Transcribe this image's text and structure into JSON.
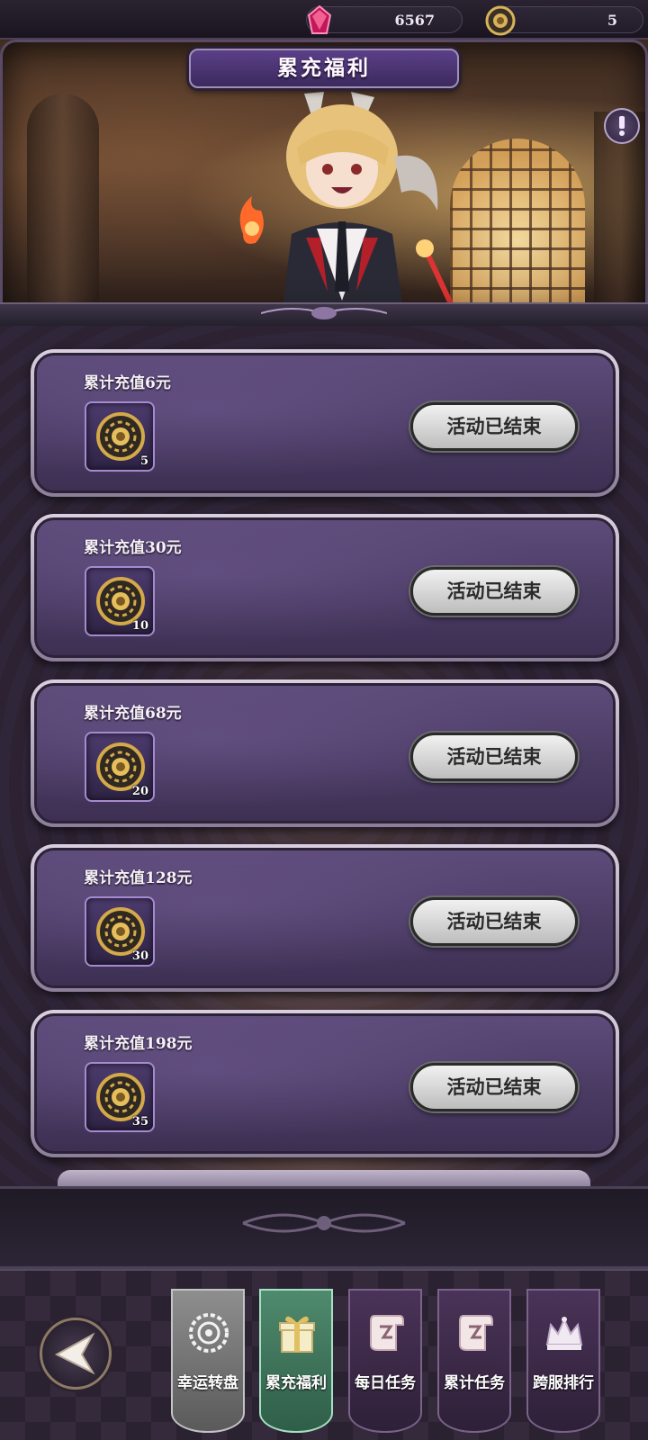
{
  "resources": {
    "gems": {
      "icon": "gem-icon",
      "value": "6567"
    },
    "coins": {
      "icon": "chip-coin-icon",
      "value": "5"
    }
  },
  "banner": {
    "title": "累充福利",
    "info_icon": "info-icon"
  },
  "tiers": [
    {
      "title": "累计充值6元",
      "reward_icon": "chip-coin-icon",
      "reward_qty": "5",
      "button": "活动已结束"
    },
    {
      "title": "累计充值30元",
      "reward_icon": "chip-coin-icon",
      "reward_qty": "10",
      "button": "活动已结束"
    },
    {
      "title": "累计充值68元",
      "reward_icon": "chip-coin-icon",
      "reward_qty": "20",
      "button": "活动已结束"
    },
    {
      "title": "累计充值128元",
      "reward_icon": "chip-coin-icon",
      "reward_qty": "30",
      "button": "活动已结束"
    },
    {
      "title": "累计充值198元",
      "reward_icon": "chip-coin-icon",
      "reward_qty": "35",
      "button": "活动已结束"
    }
  ],
  "nav": {
    "back_icon": "back-arrow-icon",
    "tabs": [
      {
        "label": "幸运转盘",
        "icon": "wheel-icon",
        "state": "disabled"
      },
      {
        "label": "累充福利",
        "icon": "gift-icon",
        "state": "active"
      },
      {
        "label": "每日任务",
        "icon": "scroll-icon",
        "state": "normal"
      },
      {
        "label": "累计任务",
        "icon": "scroll-icon",
        "state": "normal"
      },
      {
        "label": "跨服排行",
        "icon": "crown-icon",
        "state": "normal"
      }
    ]
  },
  "colors": {
    "active_tab": "#4f8a6e",
    "card_bg": "#4a3b63",
    "accent_border": "#a58ad0"
  }
}
